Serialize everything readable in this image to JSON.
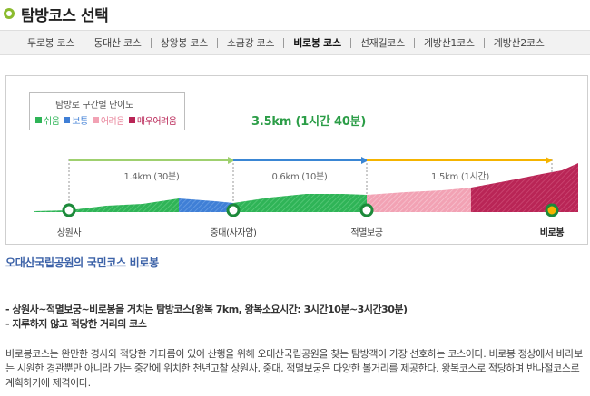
{
  "page": {
    "title": "탐방코스 선택"
  },
  "tabs": [
    {
      "label": "두로봉 코스",
      "active": false
    },
    {
      "label": "동대산 코스",
      "active": false
    },
    {
      "label": "상왕봉 코스",
      "active": false
    },
    {
      "label": "소금강 코스",
      "active": false
    },
    {
      "label": "비로봉 코스",
      "active": true
    },
    {
      "label": "선재길코스",
      "active": false
    },
    {
      "label": "계방산1코스",
      "active": false
    },
    {
      "label": "계방산2코스",
      "active": false
    }
  ],
  "legend": {
    "title": "탐방로 구간별 난이도",
    "items": [
      {
        "label": "쉬움",
        "color": "#2fb457"
      },
      {
        "label": "보통",
        "color": "#3f7fd6"
      },
      {
        "label": "어려움",
        "color": "#f2a2b4"
      },
      {
        "label": "매우어려움",
        "color": "#b92556"
      }
    ]
  },
  "course": {
    "total": "3.5km (1시간 40분)",
    "segments": [
      {
        "label": "1.4km (30분)",
        "arrow_color": "#9fd06f"
      },
      {
        "label": "0.6km (10분)",
        "arrow_color": "#3a86d4"
      },
      {
        "label": "1.5km (1시간)",
        "arrow_color": "#f5b400"
      }
    ],
    "points": [
      {
        "label": "상원사",
        "end": false
      },
      {
        "label": "중대(사자암)",
        "end": false
      },
      {
        "label": "적멸보궁",
        "end": false
      },
      {
        "label": "비로봉",
        "end": true
      }
    ]
  },
  "info": {
    "title": "오대산국립공원의 국민코스 비로봉",
    "bullets": [
      "- 상원사~적멸보궁~비로봉을 거치는 탐방코스(왕복 7km, 왕복소요시간: 3시간10분~3시간30분)",
      "- 지루하지 않고 적당한 거리의 코스"
    ],
    "description": "비로봉코스는 완만한 경사와 적당한 가파름이 있어 산행을 위해 오대산국립공원을 찾는 탐방객이 가장 선호하는 코스이다. 비로봉 정상에서 바라보는 시원한 경관뿐만 아니라 가는 중간에 위치한 천년고찰 상원사, 중대, 적멸보궁은 다양한 볼거리를 제공한다. 왕복코스로 적당하며 반나절코스로 계획하기에 제격이다."
  }
}
